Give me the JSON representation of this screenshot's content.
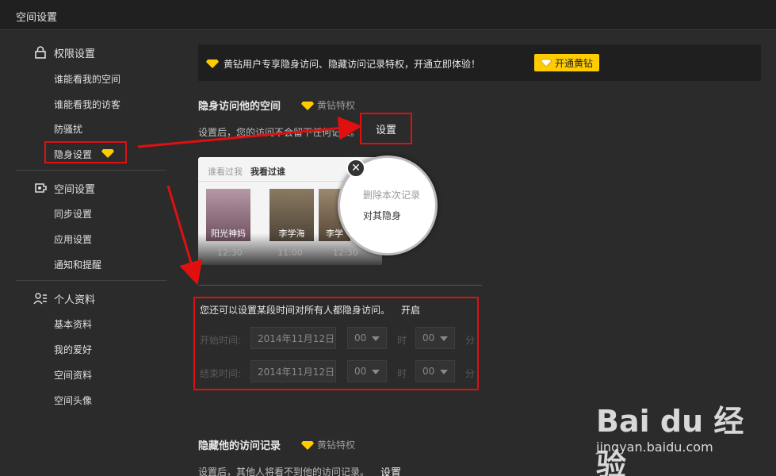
{
  "window": {
    "title": "空间设置"
  },
  "sidebar": {
    "sections": [
      {
        "title": "权限设置",
        "icon": "lock-icon",
        "items": [
          "谁能看我的空间",
          "谁能看我的访客",
          "防骚扰",
          "隐身设置"
        ]
      },
      {
        "title": "空间设置",
        "icon": "gear-icon",
        "items": [
          "同步设置",
          "应用设置",
          "通知和提醒"
        ]
      },
      {
        "title": "个人资料",
        "icon": "person-icon",
        "items": [
          "基本资料",
          "我的爱好",
          "空间资料",
          "空间头像"
        ]
      }
    ],
    "selected_item": "隐身设置"
  },
  "promo": {
    "text": "黄钻用户专享隐身访问、隐藏访问记录特权，开通立即体验！",
    "button": "开通黄钻"
  },
  "stealth": {
    "heading": "隐身访问他的空间",
    "tag": "黄钻特权",
    "desc": "设置后，您的访问不会留下任何记录。",
    "button": "设置"
  },
  "preview": {
    "tab_inactive": "谁看过我",
    "tab_active": "我看过谁",
    "people": [
      {
        "name": "阳光神妈",
        "time": "12:30"
      },
      {
        "name": "李学海",
        "time": "11:00"
      },
      {
        "name": "李学",
        "time": "12:30"
      }
    ],
    "menu": {
      "delete": "删除本次记录",
      "hide": "对其隐身"
    }
  },
  "schedule": {
    "intro": "您还可以设置某段时间对所有人都隐身访问。",
    "toggle": "开启",
    "start_label": "开始时间:",
    "end_label": "结束时间:",
    "date": "2014年11月12日",
    "hour": "00",
    "minute": "00",
    "hour_unit": "时",
    "minute_unit": "分"
  },
  "hide_records": {
    "heading": "隐藏他的访问记录",
    "tag": "黄钻特权",
    "desc": "设置后，其他人将看不到他的访问记录。",
    "button": "设置"
  },
  "watermark": {
    "logo": "Bai du 经验",
    "url": "jingyan.baidu.com"
  },
  "colors": {
    "background": "#2b2b2b",
    "highlight": "#e01010",
    "gold": "#ffcc00"
  }
}
